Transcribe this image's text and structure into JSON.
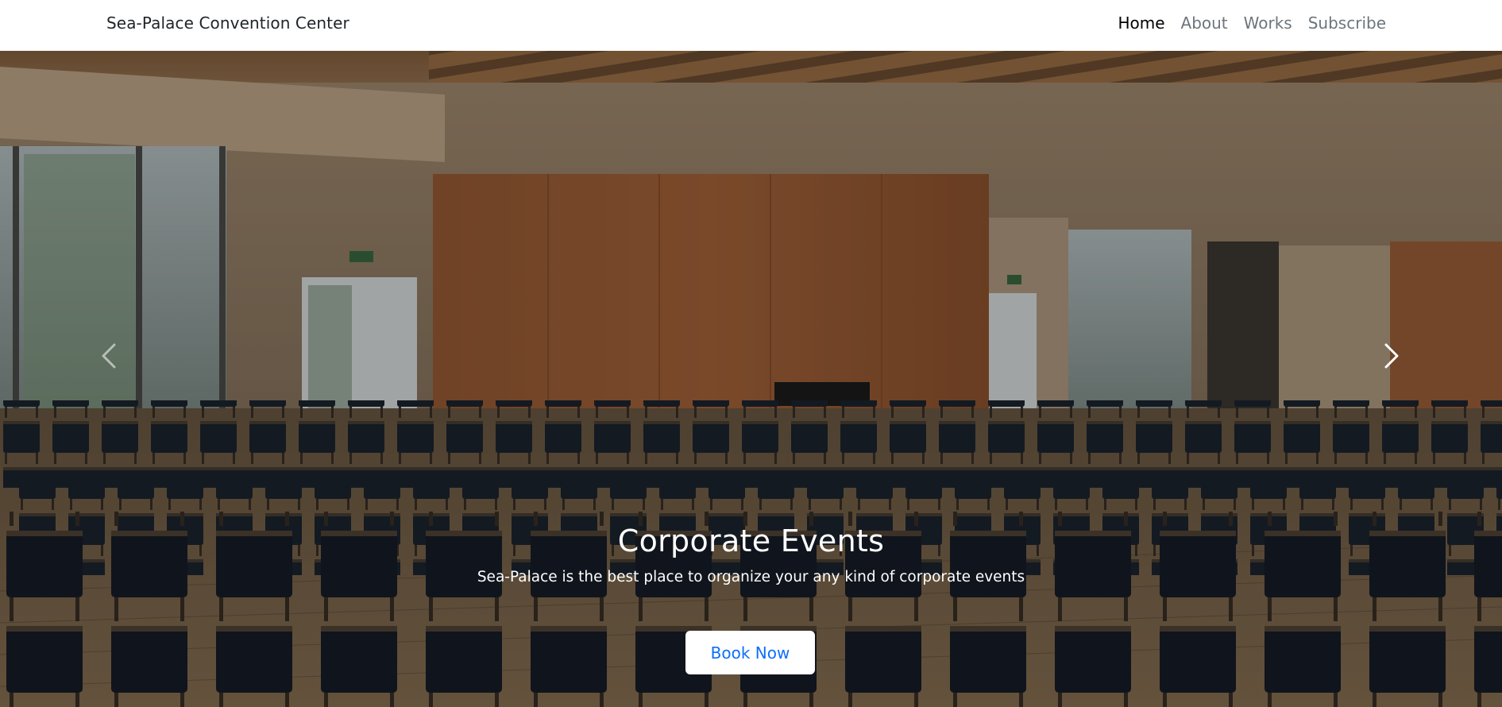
{
  "navbar": {
    "brand": "Sea-Palace Convention Center",
    "links": [
      {
        "label": "Home",
        "active": true
      },
      {
        "label": "About",
        "active": false
      },
      {
        "label": "Works",
        "active": false
      },
      {
        "label": "Subscribe",
        "active": false
      }
    ]
  },
  "hero": {
    "title": "Corporate Events",
    "subtitle": "Sea-Palace is the best place to organize your any kind of corporate events",
    "button_label": "Book Now",
    "prev_icon": "chevron-left-icon",
    "next_icon": "chevron-right-icon"
  },
  "colors": {
    "nav_active": "#000000",
    "nav_inactive": "#6c757d",
    "button_text": "#0d6efd",
    "button_bg": "#ffffff"
  }
}
